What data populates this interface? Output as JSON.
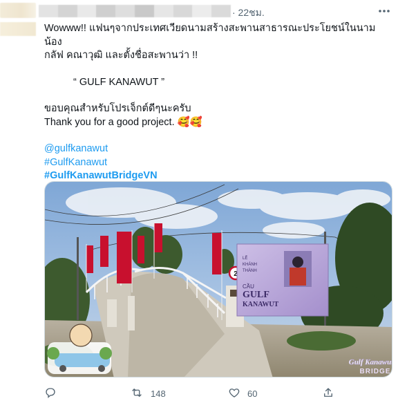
{
  "header": {
    "time": "· 22ชม.",
    "more_icon": "more-horizontal-icon"
  },
  "tweet": {
    "line1": "Wowww!! แฟนๆจากประเทศเวียดนามสร้างสะพานสาธารณะประโยชน์ในนามน้อง",
    "line2": "กลัฟ คณาวุฒิ และตั้งชื่อสะพานว่า !!",
    "title": "“ GULF KANAWUT ”",
    "thanks_th": "ขอบคุณสำหรับโปรเจ็กต์ดีๆนะครับ",
    "thanks_en": "Thank you for a good project.",
    "thanks_emoji": "🥰🥰",
    "mention": "@gulfkanawut",
    "hashtag1": "#GulfKanawut",
    "hashtag2": "#GulfKanawutBridgeVN"
  },
  "media": {
    "banner_line1": "LỄ",
    "banner_line2": "KHÁNH",
    "banner_line3": "THÀNH",
    "banner_cau": "CẦU",
    "banner_gulf": "GULF",
    "banner_kanawut": "KANAWUT",
    "sign_number": "2",
    "watermark_line1": "Gulf Kanawut",
    "watermark_line2": "BRIDGE"
  },
  "actions": {
    "reply_icon": "reply-icon",
    "retweet_icon": "retweet-icon",
    "retweet_count": "148",
    "like_icon": "heart-icon",
    "like_count": "60",
    "share_icon": "share-icon"
  },
  "colors": {
    "link": "#1d9bf0",
    "muted": "#536471",
    "flag": "#c8102e",
    "banner": "#b9a6d8"
  }
}
